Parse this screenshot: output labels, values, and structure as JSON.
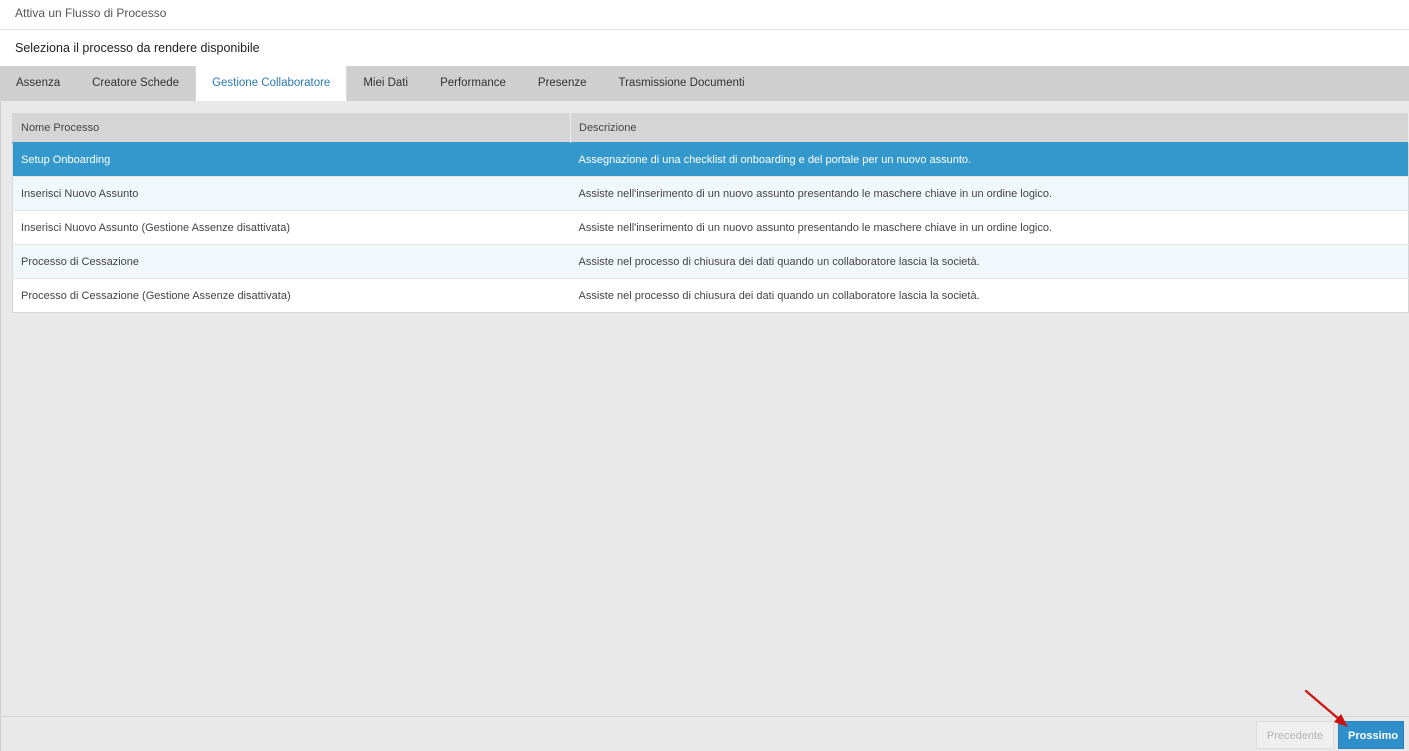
{
  "window": {
    "title": "Attiva un Flusso di Processo"
  },
  "subtitle": "Seleziona il processo da rendere disponibile",
  "tabs": [
    {
      "label": "Assenza",
      "active": false
    },
    {
      "label": "Creatore Schede",
      "active": false
    },
    {
      "label": "Gestione Collaboratore",
      "active": true
    },
    {
      "label": "Miei Dati",
      "active": false
    },
    {
      "label": "Performance",
      "active": false
    },
    {
      "label": "Presenze",
      "active": false
    },
    {
      "label": "Trasmissione Documenti",
      "active": false
    }
  ],
  "table": {
    "columns": [
      "Nome Processo",
      "Descrizione"
    ],
    "rows": [
      {
        "name": "Setup Onboarding",
        "description": "Assegnazione di una checklist di onboarding e del portale per un nuovo assunto.",
        "selected": true
      },
      {
        "name": "Inserisci Nuovo Assunto",
        "description": "Assiste nell'inserimento di un nuovo assunto presentando le maschere chiave in un ordine logico.",
        "selected": false
      },
      {
        "name": "Inserisci Nuovo Assunto (Gestione Assenze disattivata)",
        "description": "Assiste nell'inserimento di un nuovo assunto presentando le maschere chiave in un ordine logico.",
        "selected": false
      },
      {
        "name": "Processo di Cessazione",
        "description": "Assiste nel processo di chiusura dei dati quando un collaboratore lascia la società.",
        "selected": false
      },
      {
        "name": "Processo di Cessazione (Gestione Assenze disattivata)",
        "description": "Assiste nel processo di chiusura dei dati quando un collaboratore lascia la società.",
        "selected": false
      }
    ]
  },
  "footer": {
    "prev_label": "Precedente",
    "next_label": "Prossimo"
  },
  "colors": {
    "selected_row": "#3399cc",
    "active_tab_text": "#2a7ab5",
    "next_button": "#2f8fcb",
    "annotation_arrow": "#cc1111"
  },
  "icons": {
    "annotation": "red-arrow-icon"
  }
}
